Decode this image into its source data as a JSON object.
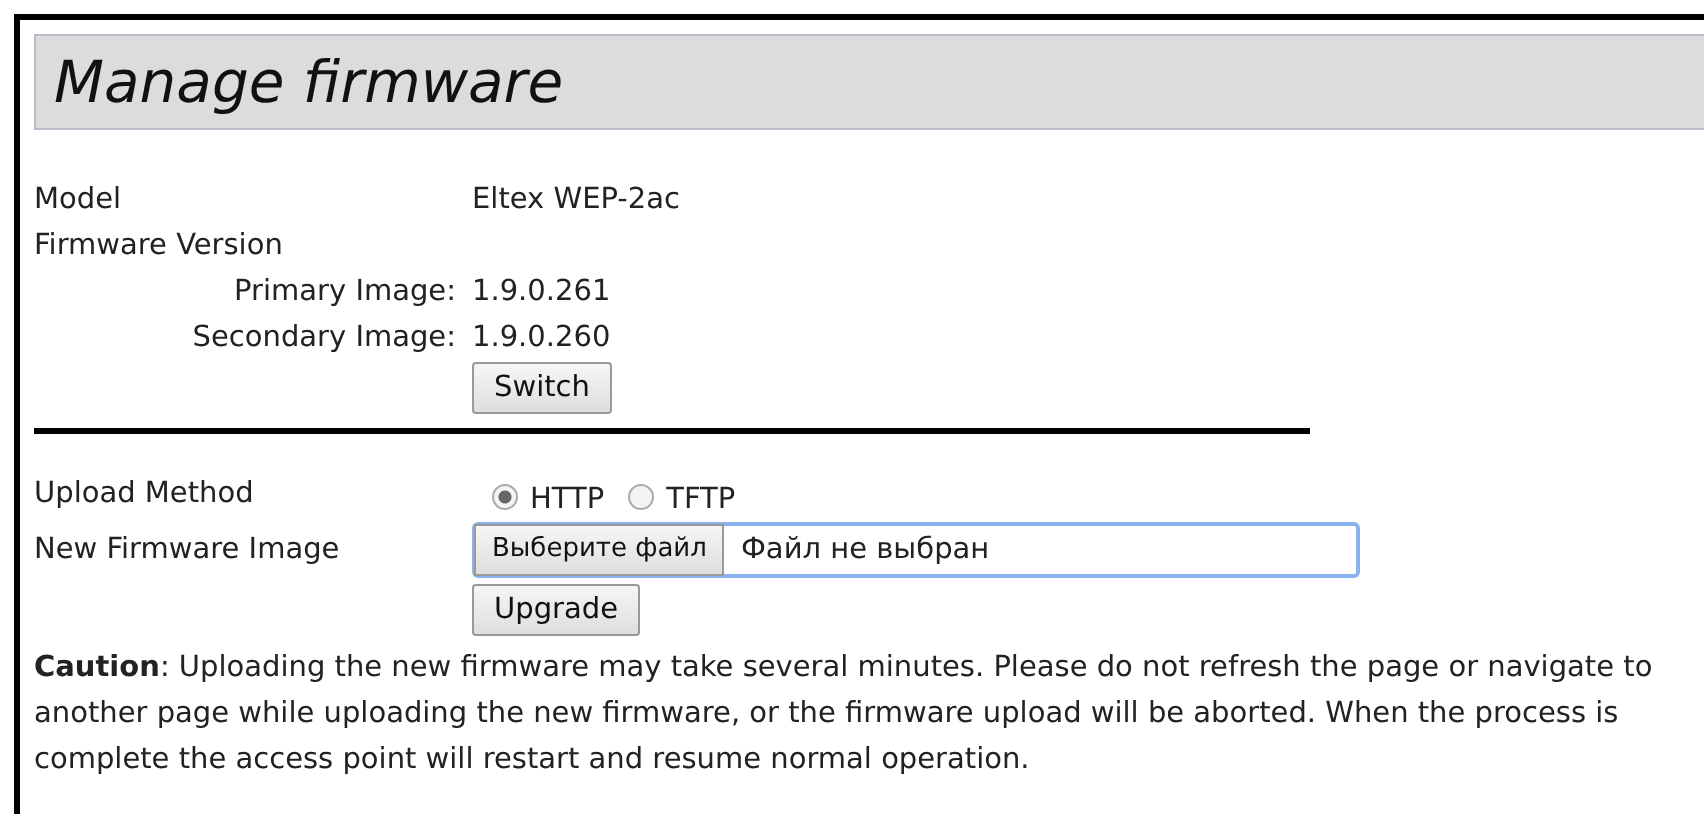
{
  "page": {
    "title": "Manage firmware"
  },
  "info": [
    {
      "kind": "field",
      "label": "Model",
      "value": "Eltex WEP-2ac"
    },
    {
      "kind": "heading",
      "label": "Firmware Version"
    },
    {
      "kind": "sub",
      "label": "Primary Image:",
      "value": "1.9.0.261"
    },
    {
      "kind": "sub",
      "label": "Secondary Image:",
      "value": "1.9.0.260"
    }
  ],
  "switch_button": "Switch",
  "upload_method": {
    "label": "Upload Method",
    "options": [
      {
        "label": "HTTP",
        "selected": true
      },
      {
        "label": "TFTP",
        "selected": false
      }
    ]
  },
  "new_firmware_image": {
    "label": "New Firmware Image",
    "button": "Выберите файл",
    "status": "Файл не выбран"
  },
  "upgrade_button": "Upgrade",
  "caution": "**Caution**: Uploading the new firmware may take several minutes. Please do not refresh the page or navigate to another page while uploading the new firmware, or the firmware upload will be aborted. When the process is complete the access point will restart and resume normal operation."
}
